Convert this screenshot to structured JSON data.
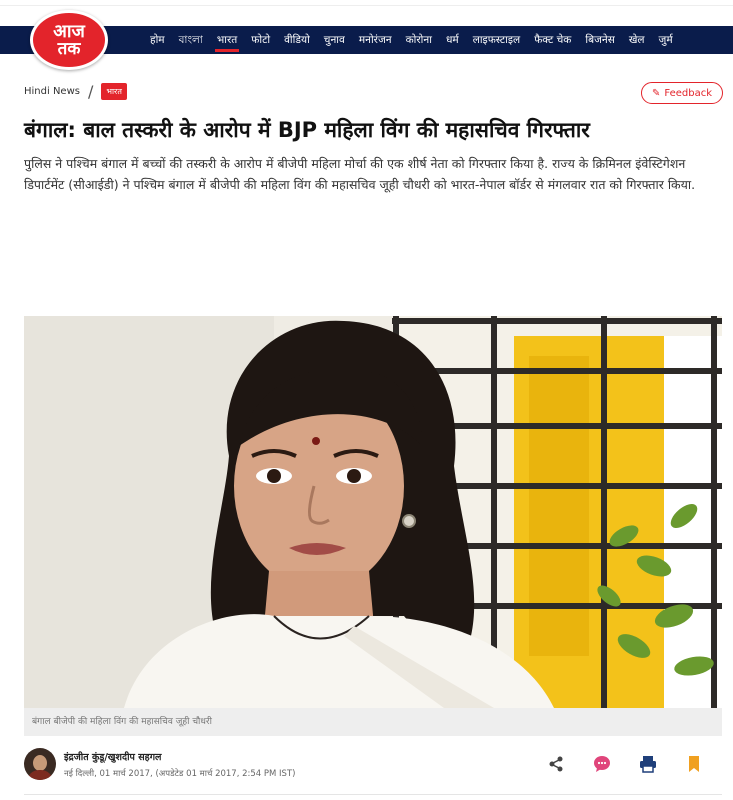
{
  "site": {
    "logo_line1": "आज",
    "logo_line2": "तक"
  },
  "nav": {
    "items": [
      {
        "label": "होम"
      },
      {
        "label": "বাংলা"
      },
      {
        "label": "भारत",
        "active": true
      },
      {
        "label": "फोटो"
      },
      {
        "label": "वीडियो"
      },
      {
        "label": "चुनाव"
      },
      {
        "label": "मनोरंजन"
      },
      {
        "label": "कोरोना"
      },
      {
        "label": "धर्म"
      },
      {
        "label": "लाइफस्टाइल"
      },
      {
        "label": "फैक्ट चेक"
      },
      {
        "label": "बिजनेस"
      },
      {
        "label": "खेल"
      },
      {
        "label": "जुर्म"
      }
    ]
  },
  "breadcrumb": {
    "home": "Hindi News",
    "separator": "/",
    "section": "भारत"
  },
  "feedback": {
    "label": "Feedback",
    "icon": "pencil-icon"
  },
  "article": {
    "headline": "बंगाल: बाल तस्करी के आरोप में BJP महिला विंग की महासचिव गिरफ्तार",
    "summary": "पुलिस ने पश्चिम बंगाल में बच्चों की तस्करी के आरोप में बीजेपी महिला मोर्चा की एक शीर्ष नेता को गिरफ्तार किया है. राज्य के क्रिमिनल इंवेस्टिगेशन डिपार्टमेंट (सीआईडी) ने पश्चिम बंगाल में बीजेपी की महिला विंग की महासचिव जूही चौधरी को भारत-नेपाल बॉर्डर से मंगलवार रात को गिरफ्तार किया.",
    "image_caption": "बंगाल बीजेपी की महिला विंग की महासचिव जूही चौधरी",
    "author": "इंद्रजीत कुंडू/खुशदीप सहगल",
    "dateline": "नई दिल्ली, 01 मार्च 2017, (अपडेटेड 01 मार्च 2017, 2:54 PM IST)"
  },
  "actions": [
    {
      "name": "share-icon",
      "color": "#444444"
    },
    {
      "name": "comment-icon",
      "color": "#e0457b"
    },
    {
      "name": "print-icon",
      "color": "#1f3f7a"
    },
    {
      "name": "bookmark-icon",
      "color": "#f0a020"
    }
  ],
  "colors": {
    "nav_bg": "#0a1c4b",
    "brand_red": "#e3242b"
  }
}
